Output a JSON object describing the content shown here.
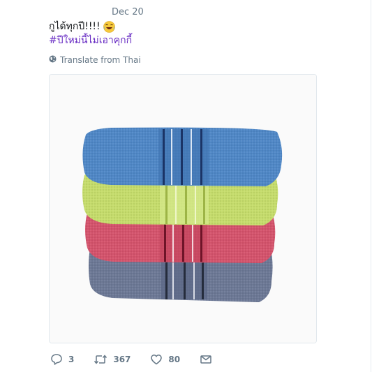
{
  "tweet": {
    "timestamp": "Dec 20",
    "text": "กูได้ทุกปี!!!!",
    "emoji": "face-with-tears-of-joy",
    "hashtag": "#ปีใหม่นี้ไม่เอาคุกกี้",
    "translate_label": "Translate from Thai"
  },
  "media": {
    "description_icon": "stacked-towels-image",
    "towel_colors": [
      "#4f87c6",
      "#c5dc6b",
      "#d4536c",
      "#6c7895"
    ]
  },
  "actions": {
    "reply_count": "3",
    "retweet_count": "367",
    "like_count": "80"
  },
  "colors": {
    "secondary_text": "#657786",
    "hashtag": "#6a2fc4",
    "border": "#e1e8ed"
  }
}
